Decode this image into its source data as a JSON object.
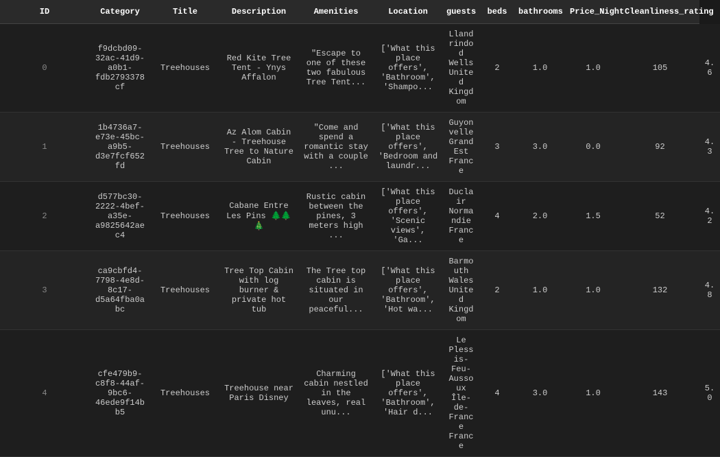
{
  "table": {
    "columns": [
      "ID",
      "Category",
      "Title",
      "Description",
      "Amenities",
      "Location",
      "guests",
      "beds",
      "bathrooms",
      "Price_Night",
      "Cleanliness_rating"
    ],
    "rows": [
      {
        "index": 0,
        "id": "f9dcbd09-32ac-41d9-a0b1-fdb2793378cf",
        "category": "Treehouses",
        "title": "Red Kite Tree Tent - Ynys Affalon",
        "description": "\"Escape to one of these two fabulous Tree Tent...",
        "amenities": "['What this place offers', 'Bathroom', 'Shampo...",
        "location": "Llandrindod Wells United Kingdom",
        "guests": "2",
        "beds": "1.0",
        "bathrooms": "1.0",
        "price_night": "105",
        "cleanliness_rating": "4.6"
      },
      {
        "index": 1,
        "id": "1b4736a7-e73e-45bc-a9b5-d3e7fcf652fd",
        "category": "Treehouses",
        "title": "Az Alom Cabin - Treehouse Tree to Nature Cabin",
        "description": "\"Come and spend a romantic stay with a couple ...",
        "amenities": "['What this place offers', 'Bedroom and laundr...",
        "location": "Guyonvelle Grand Est France",
        "guests": "3",
        "beds": "3.0",
        "bathrooms": "0.0",
        "price_night": "92",
        "cleanliness_rating": "4.3"
      },
      {
        "index": 2,
        "id": "d577bc30-2222-4bef-a35e-a9825642aec4",
        "category": "Treehouses",
        "title": "Cabane Entre Les Pins\n🌲🌲🎄",
        "description": "Rustic cabin between the pines, 3 meters high ...",
        "amenities": "['What this place offers', 'Scenic views', 'Ga...",
        "location": "Duclair Normandie France",
        "guests": "4",
        "beds": "2.0",
        "bathrooms": "1.5",
        "price_night": "52",
        "cleanliness_rating": "4.2"
      },
      {
        "index": 3,
        "id": "ca9cbfd4-7798-4e8d-8c17-d5a64fba0abc",
        "category": "Treehouses",
        "title": "Tree Top Cabin with log burner & private hot tub",
        "description": "The Tree top cabin is situated in our peaceful...",
        "amenities": "['What this place offers', 'Bathroom', 'Hot wa...",
        "location": "Barmouth Wales United Kingdom",
        "guests": "2",
        "beds": "1.0",
        "bathrooms": "1.0",
        "price_night": "132",
        "cleanliness_rating": "4.8"
      },
      {
        "index": 4,
        "id": "cfe479b9-c8f8-44af-9bc6-46ede9f14bb5",
        "category": "Treehouses",
        "title": "Treehouse near Paris Disney",
        "description": "Charming cabin nestled in the leaves, real unu...",
        "amenities": "['What this place offers', 'Bathroom', 'Hair d...",
        "location": "Le Plessis-Feu-Aussoux Île-de-France France",
        "guests": "4",
        "beds": "3.0",
        "bathrooms": "1.0",
        "price_night": "143",
        "cleanliness_rating": "5.0"
      }
    ]
  }
}
